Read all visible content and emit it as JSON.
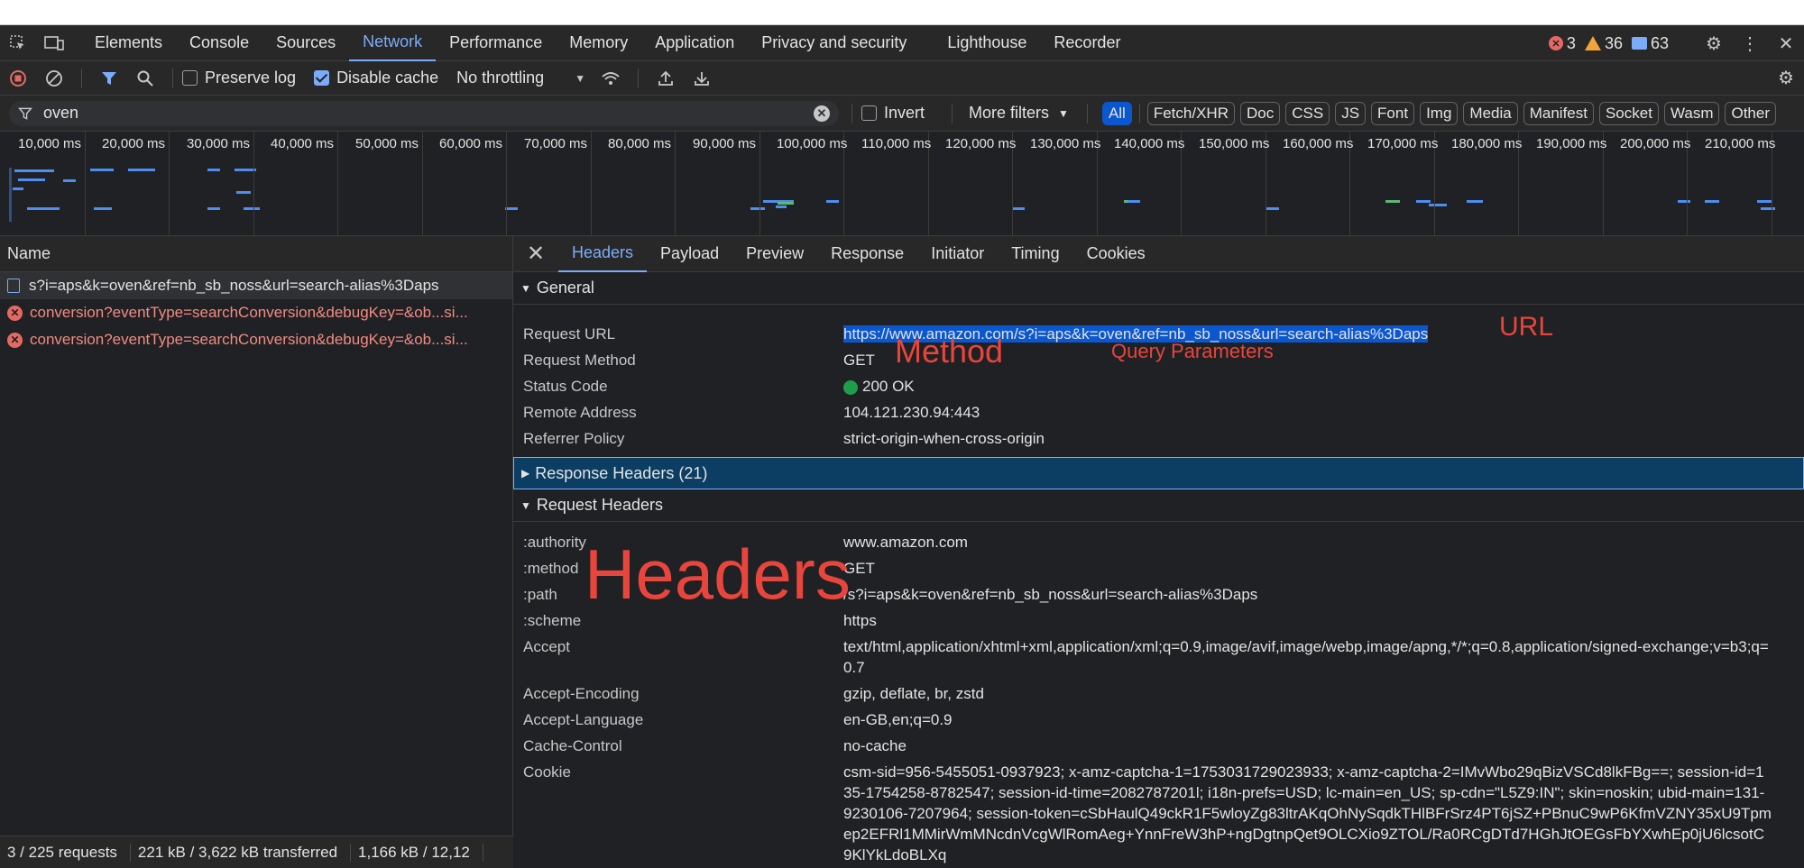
{
  "main_tabs": [
    "Elements",
    "Console",
    "Sources",
    "Network",
    "Performance",
    "Memory",
    "Application",
    "Privacy and security",
    "Lighthouse",
    "Recorder"
  ],
  "active_main_tab": "Network",
  "counts": {
    "errors": "3",
    "warnings": "36",
    "messages": "63"
  },
  "toolbar": {
    "preserve_log": "Preserve log",
    "disable_cache": "Disable cache",
    "throttling": "No throttling"
  },
  "filter": {
    "value": "oven",
    "invert": "Invert",
    "more_filters": "More filters",
    "types": [
      "All",
      "Fetch/XHR",
      "Doc",
      "CSS",
      "JS",
      "Font",
      "Img",
      "Media",
      "Manifest",
      "Socket",
      "Wasm",
      "Other"
    ]
  },
  "overview_ticks": [
    "10,000 ms",
    "20,000 ms",
    "30,000 ms",
    "40,000 ms",
    "50,000 ms",
    "60,000 ms",
    "70,000 ms",
    "80,000 ms",
    "90,000 ms",
    "100,000 ms",
    "110,000 ms",
    "120,000 ms",
    "130,000 ms",
    "140,000 ms",
    "150,000 ms",
    "160,000 ms",
    "170,000 ms",
    "180,000 ms",
    "190,000 ms",
    "200,000 ms",
    "210,000 ms",
    "22("
  ],
  "requests": {
    "header": "Name",
    "rows": [
      "s?i=aps&k=oven&ref=nb_sb_noss&url=search-alias%3Daps",
      "conversion?eventType=searchConversion&debugKey=&ob...si...",
      "conversion?eventType=searchConversion&debugKey=&ob...si..."
    ]
  },
  "status": {
    "requests": "3 / 225 requests",
    "transferred": "221 kB / 3,622 kB transferred",
    "resources": "1,166 kB / 12,12"
  },
  "detail_tabs": [
    "Headers",
    "Payload",
    "Preview",
    "Response",
    "Initiator",
    "Timing",
    "Cookies"
  ],
  "general": {
    "title": "General",
    "rows": [
      {
        "k": "Request URL",
        "v": "https://www.amazon.com/s?i=aps&k=oven&ref=nb_sb_noss&url=search-alias%3Daps"
      },
      {
        "k": "Request Method",
        "v": "GET"
      },
      {
        "k": "Status Code",
        "v": "200 OK"
      },
      {
        "k": "Remote Address",
        "v": "104.121.230.94:443"
      },
      {
        "k": "Referrer Policy",
        "v": "strict-origin-when-cross-origin"
      }
    ]
  },
  "response_headers": "Response Headers (21)",
  "request_headers": {
    "title": "Request Headers",
    "rows": [
      {
        "k": ":authority",
        "v": "www.amazon.com"
      },
      {
        "k": ":method",
        "v": "GET"
      },
      {
        "k": ":path",
        "v": "/s?i=aps&k=oven&ref=nb_sb_noss&url=search-alias%3Daps"
      },
      {
        "k": ":scheme",
        "v": "https"
      },
      {
        "k": "Accept",
        "v": "text/html,application/xhtml+xml,application/xml;q=0.9,image/avif,image/webp,image/apng,*/*;q=0.8,application/signed-exchange;v=b3;q=0.7"
      },
      {
        "k": "Accept-Encoding",
        "v": "gzip, deflate, br, zstd"
      },
      {
        "k": "Accept-Language",
        "v": "en-GB,en;q=0.9"
      },
      {
        "k": "Cache-Control",
        "v": "no-cache"
      },
      {
        "k": "Cookie",
        "v": "csm-sid=956-5455051-0937923; x-amz-captcha-1=1753031729023933; x-amz-captcha-2=IMvWbo29qBizVSCd8lkFBg==; session-id=135-1754258-8782547; session-id-time=2082787201l; i18n-prefs=USD; lc-main=en_US; sp-cdn=\"L5Z9:IN\"; skin=noskin; ubid-main=131-9230106-7207964; session-token=cSbHaulQ49ckR1F5wloyZg83ltrAKqOhNySqdkTHlBFrSrz4PT6jSZ+PBnuC9wP6KfmVZNY35xU9Tpmep2EFRl1MMirWmMNcdnVcgWlRomAeg+YnnFreW3hP+ngDgtnpQet9OLCXio9ZTOL/Ra0RCgDTd7HGhJtOEGsFbYXwhEp0jU6lcsotC9KlYkLdoBLXq"
      }
    ]
  },
  "annotations": {
    "url": "URL",
    "method": "Method",
    "query": "Query Parameters",
    "headers": "Headers"
  }
}
